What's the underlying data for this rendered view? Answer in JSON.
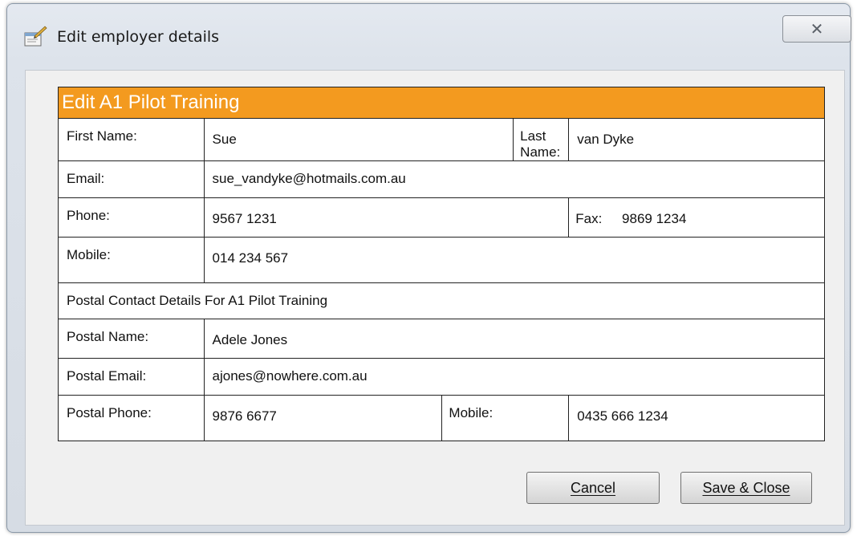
{
  "window": {
    "title": "Edit employer details",
    "close_glyph": "✕"
  },
  "form": {
    "header": "Edit A1 Pilot Training",
    "first_name_label": "First Name:",
    "first_name_value": "Sue",
    "last_name_label": "Last Name:",
    "last_name_value": "van Dyke",
    "email_label": "Email:",
    "email_value": "sue_vandyke@hotmails.com.au",
    "phone_label": "Phone:",
    "phone_value": "9567 1231",
    "fax_label": "Fax:",
    "fax_value": "9869 1234",
    "mobile_label": "Mobile:",
    "mobile_value": "014 234 567",
    "postal_section_title": "Postal Contact Details For A1 Pilot Training",
    "postal_name_label": "Postal Name:",
    "postal_name_value": "Adele Jones",
    "postal_email_label": "Postal Email:",
    "postal_email_value": "ajones@nowhere.com.au",
    "postal_phone_label": "Postal Phone:",
    "postal_phone_value": "9876 6677",
    "postal_mobile_label": "Mobile:",
    "postal_mobile_value": "0435 666 1234"
  },
  "buttons": {
    "cancel": "Cancel",
    "save_close": "Save & Close"
  },
  "colors": {
    "header_bg": "#f39a1f",
    "header_text": "#ffffff"
  },
  "icons": {
    "title_icon": "edit-properties-icon",
    "close_icon": "close-icon"
  }
}
